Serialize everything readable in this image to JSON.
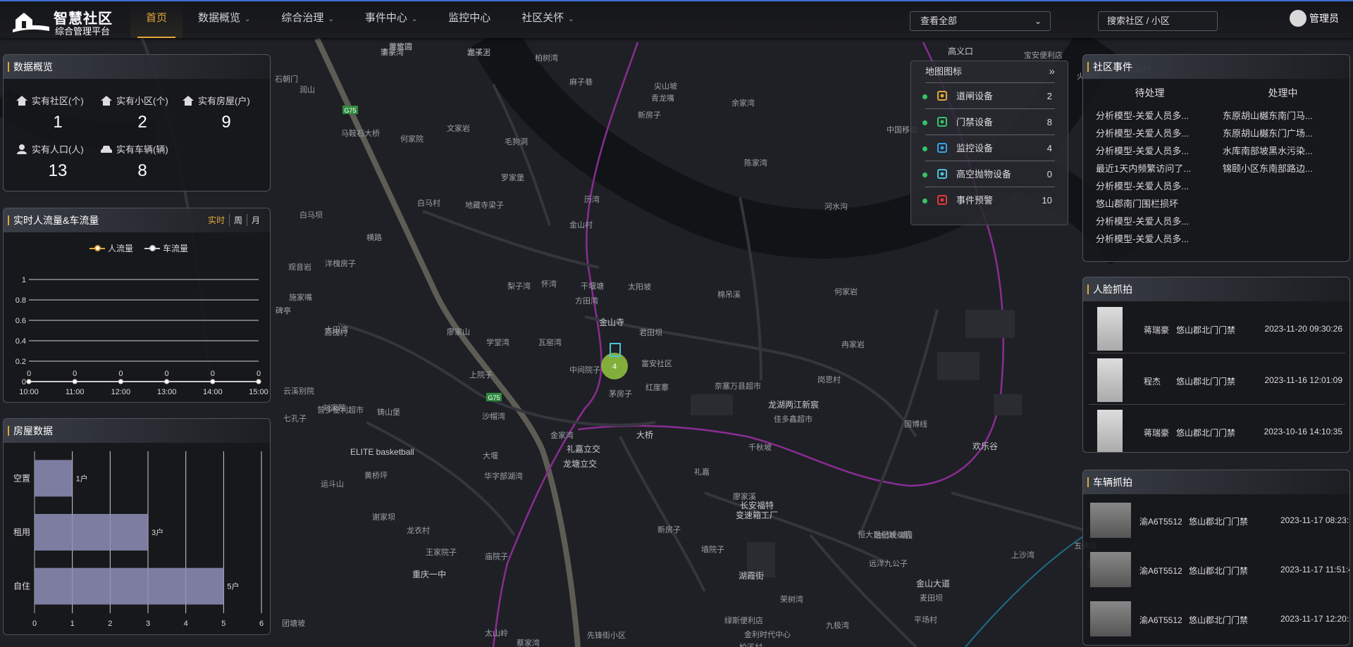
{
  "app": {
    "title_main": "智慧社区",
    "title_sub": "综合管理平台"
  },
  "nav": [
    {
      "label": "首页",
      "active": true,
      "dropdown": false
    },
    {
      "label": "数据概览",
      "dropdown": true
    },
    {
      "label": "综合治理",
      "dropdown": true
    },
    {
      "label": "事件中心",
      "dropdown": true
    },
    {
      "label": "监控中心",
      "dropdown": false
    },
    {
      "label": "社区关怀",
      "dropdown": true
    }
  ],
  "header": {
    "view_select": "查看全部",
    "search_placeholder": "搜索社区 / 小区",
    "user": "管理员"
  },
  "overview": {
    "title": "数据概览",
    "stats": [
      {
        "label": "实有社区(个)",
        "value": "1"
      },
      {
        "label": "实有小区(个)",
        "value": "2"
      },
      {
        "label": "实有房屋(户)",
        "value": "9"
      },
      {
        "label": "实有人口(人)",
        "value": "13"
      },
      {
        "label": "实有车辆(辆)",
        "value": "8"
      }
    ]
  },
  "flow": {
    "title": "实时人流量&车流量",
    "tabs": [
      "实时",
      "周",
      "月"
    ],
    "legend": [
      "人流量",
      "车流量"
    ],
    "colors": {
      "people": "#e3a63a",
      "vehicle": "#cccccc"
    }
  },
  "housing": {
    "title": "房屋数据"
  },
  "chart_data": [
    {
      "type": "line",
      "x": [
        "10:00",
        "11:00",
        "12:00",
        "13:00",
        "14:00",
        "15:00"
      ],
      "series": [
        {
          "name": "人流量",
          "values": [
            0,
            0,
            0,
            0,
            0,
            0
          ]
        },
        {
          "name": "车流量",
          "values": [
            0,
            0,
            0,
            0,
            0,
            0
          ]
        }
      ],
      "y_ticks": [
        "0",
        "0.2",
        "0.4",
        "0.6",
        "0.8",
        "1"
      ],
      "ylim": [
        0,
        1
      ],
      "data_labels": [
        "0",
        "0",
        "0",
        "0",
        "0",
        "0"
      ],
      "grid": true,
      "legend": "top"
    },
    {
      "type": "bar",
      "orientation": "horizontal",
      "categories": [
        "空置",
        "租用",
        "自住"
      ],
      "values": [
        1,
        3,
        5
      ],
      "data_labels": [
        "1户",
        "3户",
        "5户"
      ],
      "x_ticks": [
        "0",
        "1",
        "2",
        "3",
        "4",
        "5",
        "6"
      ],
      "xlim": [
        0,
        6
      ],
      "grid": true
    }
  ],
  "map_icons": {
    "title": "地图图标",
    "rows": [
      {
        "label": "道闸设备",
        "count": "2",
        "icon": "barrier-gate-icon",
        "color": "#e3a63a"
      },
      {
        "label": "门禁设备",
        "count": "8",
        "icon": "door-access-icon",
        "color": "#35c36a"
      },
      {
        "label": "监控设备",
        "count": "4",
        "icon": "camera-icon",
        "color": "#3aa0e3"
      },
      {
        "label": "高空抛物设备",
        "count": "0",
        "icon": "high-altitude-camera-icon",
        "color": "#4fc3d9"
      },
      {
        "label": "事件预警",
        "count": "10",
        "icon": "alarm-icon",
        "color": "#e33a3a"
      }
    ]
  },
  "events": {
    "title": "社区事件",
    "columns": [
      "待处理",
      "处理中"
    ],
    "pending": [
      "分析模型-关爱人员多...",
      "分析模型-关爱人员多...",
      "分析模型-关爱人员多...",
      "最近1天内频繁访问了...",
      "分析模型-关爱人员多...",
      "悠山郡南门围栏损坏",
      "分析模型-关爱人员多...",
      "分析模型-关爱人员多..."
    ],
    "processing": [
      "东原胡山樾东南门马...",
      "东原胡山樾东门广场...",
      "水库南部坡黑水污染...",
      "锦颐小区东南部路边..."
    ]
  },
  "faces": {
    "title": "人脸抓拍",
    "rows": [
      {
        "name": "蒋瑞豪",
        "place": "悠山郡北门门禁",
        "time": "2023-11-20 09:30:26"
      },
      {
        "name": "程杰",
        "place": "悠山郡北门门禁",
        "time": "2023-11-16 12:01:09"
      },
      {
        "name": "蒋瑞豪",
        "place": "悠山郡北门门禁",
        "time": "2023-10-16 14:10:35"
      }
    ]
  },
  "vehicles": {
    "title": "车辆抓拍",
    "rows": [
      {
        "plate": "渝A6T5512",
        "place": "悠山郡北门门禁",
        "time": "2023-11-17 08:23:1"
      },
      {
        "plate": "渝A6T5512",
        "place": "悠山郡北门门禁",
        "time": "2023-11-17 11:51:4"
      },
      {
        "plate": "渝A6T5512",
        "place": "悠山郡北门门禁",
        "time": "2023-11-17 12:20:5"
      }
    ]
  },
  "map": {
    "cluster_count": "4",
    "labels": [
      "蒋家湾",
      "李子湾",
      "龙溪河",
      "柏树湾",
      "高义口",
      "宝安便利店",
      "石朝门",
      "润山",
      "麻子巷",
      "尖山坡",
      "青龙嘴",
      "新房子",
      "马鞍石大桥",
      "何家院",
      "文家岩",
      "毛狗洞",
      "余家湾",
      "中国移动",
      "陈家湾",
      "罗家堡",
      "白马村",
      "地藏寺梁子",
      "历湾",
      "白马坝",
      "金山村",
      "河水沟",
      "横路",
      "观音岩",
      "洋槐房子",
      "梨子湾",
      "怀湾",
      "干堰塘",
      "太阳坡",
      "棉吊溪",
      "何家岩",
      "施家嘴",
      "方田湾",
      "碑亭",
      "蒿槐村",
      "大田湾",
      "廖家山",
      "学堂湾",
      "瓦窑湾",
      "金山寺",
      "君田坝",
      "冉家岩",
      "中间院子",
      "富安社区",
      "岗思村",
      "云溪别院",
      "刘家院",
      "红崖寨",
      "奈塞万县超市",
      "龙湖两江新宸",
      "佳多鑫超市",
      "营多便利超市",
      "七孔子",
      "铸山堡",
      "沙帽湾",
      "上院子",
      "茅房子",
      "大桥",
      "国博线",
      "金家湾",
      "千秋坡",
      "欢乐谷",
      "大堰",
      "礼嘉立交",
      "龙塘立交",
      "礼嘉",
      "ELITE basketball",
      "黄桥坪",
      "华字部湖湾",
      "运斗山",
      "廖家溪",
      "长安福特",
      "变速箱工厂",
      "谢家坝",
      "龙衣村",
      "新房子",
      "融创玫瑰园",
      "墙院子",
      "恒大世纪城-2期",
      "庙院子",
      "王家院子",
      "远洋九公子",
      "上沙湾",
      "五佛寺",
      "袁家湾",
      "重庆一中",
      "湖霞街",
      "荣树湾",
      "麦田坝",
      "平场村",
      "绿斯便利店",
      "金利时代中心",
      "团塘坡",
      "太山岭",
      "蔡家湾",
      "先锋街小区",
      "柏溪村",
      "九极湾",
      "大云村",
      "火强湾",
      "金山大道",
      "雪竹园",
      "清家湾",
      "岩子上"
    ]
  }
}
